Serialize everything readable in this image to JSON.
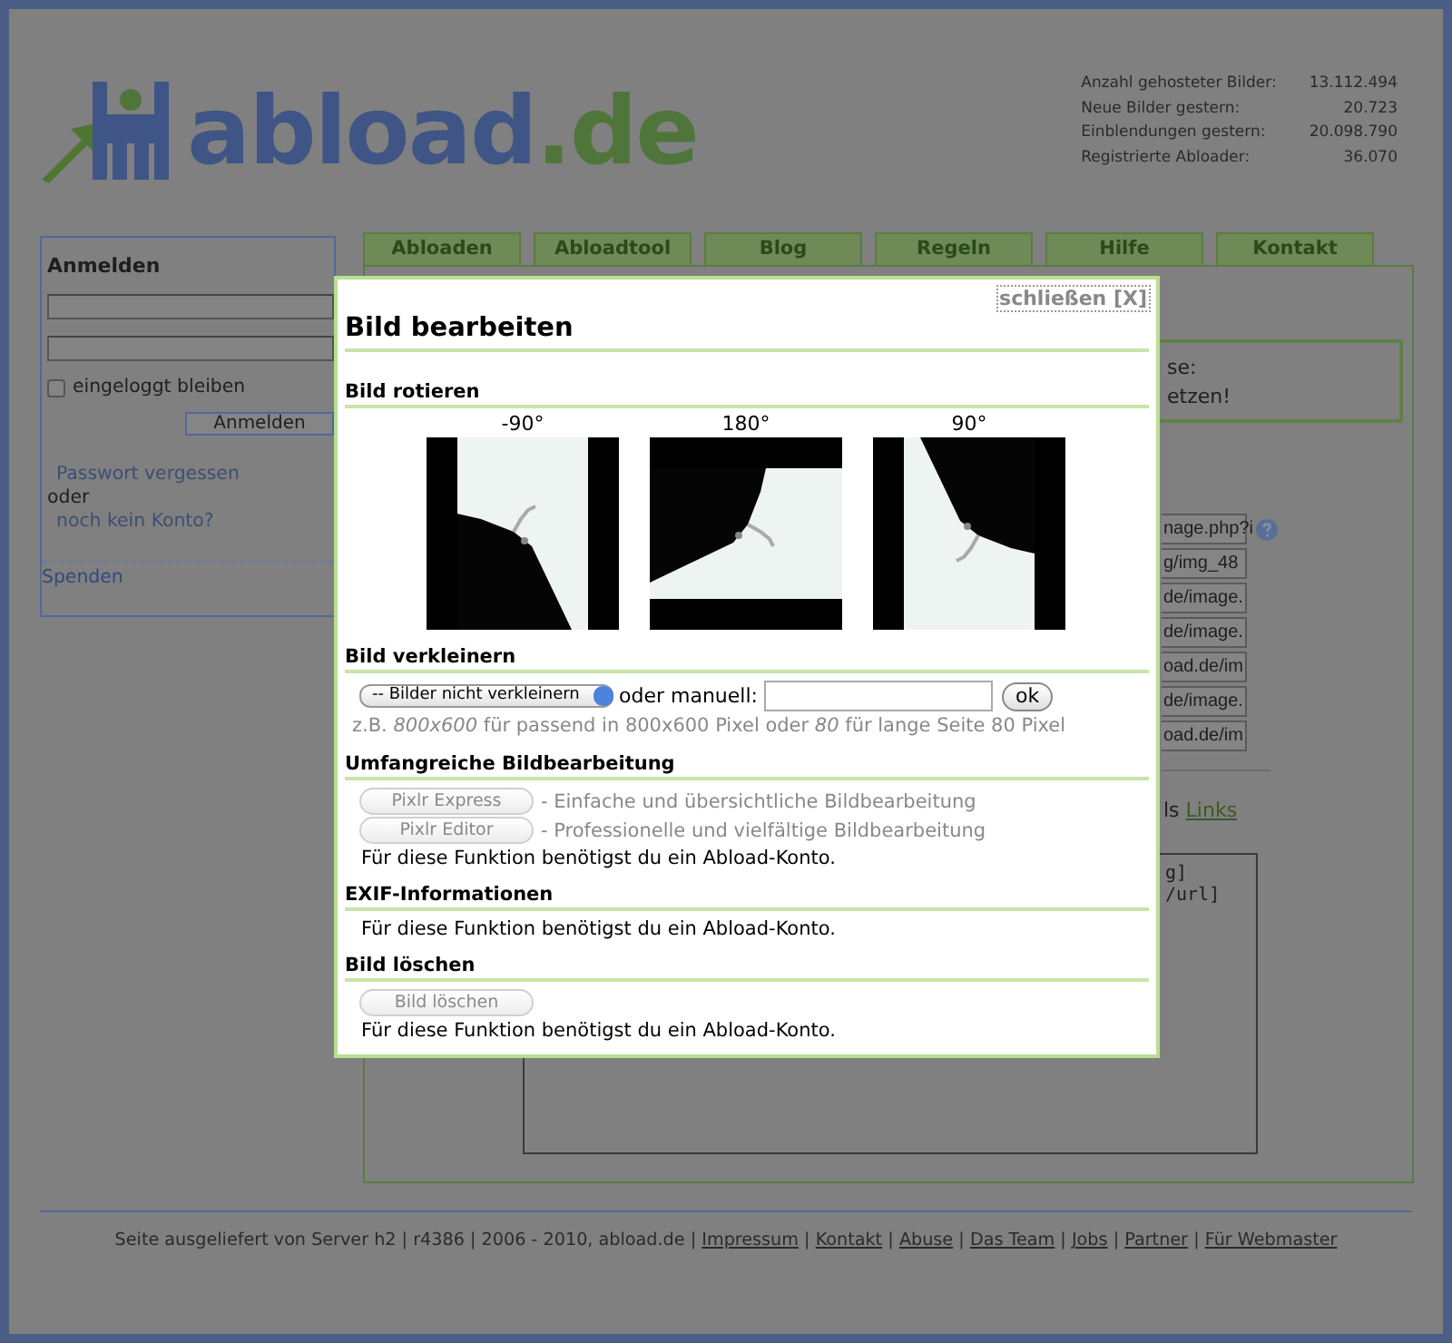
{
  "header": {
    "logo": {
      "main": "abload",
      "suffix": ".de"
    },
    "stats": [
      {
        "label": "Anzahl gehosteter Bilder:",
        "value": "13.112.494"
      },
      {
        "label": "Neue Bilder gestern:",
        "value": "20.723"
      },
      {
        "label": "Einblendungen gestern:",
        "value": "20.098.790"
      },
      {
        "label": "Registrierte Abloader:",
        "value": "36.070"
      }
    ]
  },
  "login": {
    "title": "Anmelden",
    "remember": {
      "label": "eingeloggt bleiben",
      "checked": false
    },
    "button": "Anmelden",
    "forgot": "Passwort vergessen",
    "or": "oder",
    "register": "noch kein Konto?",
    "donate": "Spenden"
  },
  "tabs": [
    {
      "label": "Abloaden",
      "selected": false
    },
    {
      "label": "Abloadtool",
      "selected": false
    },
    {
      "label": "Blog",
      "selected": false
    },
    {
      "label": "Regeln",
      "selected": false
    },
    {
      "label": "Hilfe",
      "selected": false
    },
    {
      "label": "Kontakt",
      "selected": false
    }
  ],
  "content": {
    "notice": [
      "se:",
      "etzen!"
    ],
    "link_fields": [
      "nage.php?i",
      "g/img_48",
      "de/image.",
      "de/image.",
      "oad.de/im",
      "de/image.",
      "oad.de/im"
    ],
    "links_line": {
      "prefix": "ls",
      "link": "Links"
    },
    "code": [
      "g]",
      "/url]"
    ]
  },
  "modal": {
    "close": "schließen [X]",
    "title": "Bild bearbeiten",
    "rotate": {
      "heading": "Bild rotieren",
      "options": [
        {
          "label": "-90°"
        },
        {
          "label": "180°"
        },
        {
          "label": "90°"
        }
      ]
    },
    "resize": {
      "heading": "Bild verkleinern",
      "select": "-- Bilder nicht verkleinern",
      "or_label": "oder manuell:",
      "button": "ok",
      "hint": "z.B. *800x600* für passend in 800x600 Pixel oder *80* für lange Seite 80 Pixel"
    },
    "editor": {
      "heading": "Umfangreiche Bildbearbeitung",
      "tools": [
        {
          "button": "Pixlr Express",
          "description": "- Einfache und übersichtliche Bildbearbeitung",
          "disabled": true
        },
        {
          "button": "Pixlr Editor",
          "description": "- Professionelle und vielfältige Bildbearbeitung",
          "disabled": true
        }
      ],
      "note": "Für diese Funktion benötigst du ein Abload-Konto."
    },
    "exif": {
      "heading": "EXIF-Informationen",
      "note": "Für diese Funktion benötigst du ein Abload-Konto."
    },
    "delete": {
      "heading": "Bild löschen",
      "button": "Bild löschen",
      "disabled": true,
      "note": "Für diese Funktion benötigst du ein Abload-Konto."
    }
  },
  "footer": {
    "text": "Seite ausgeliefert von Server h2 | r4386 | 2006 - 2010, abload.de",
    "separator": "|",
    "links": [
      "Impressum",
      "Kontakt",
      "Abuse",
      "Das Team",
      "Jobs",
      "Partner",
      "Für Webmaster"
    ]
  }
}
